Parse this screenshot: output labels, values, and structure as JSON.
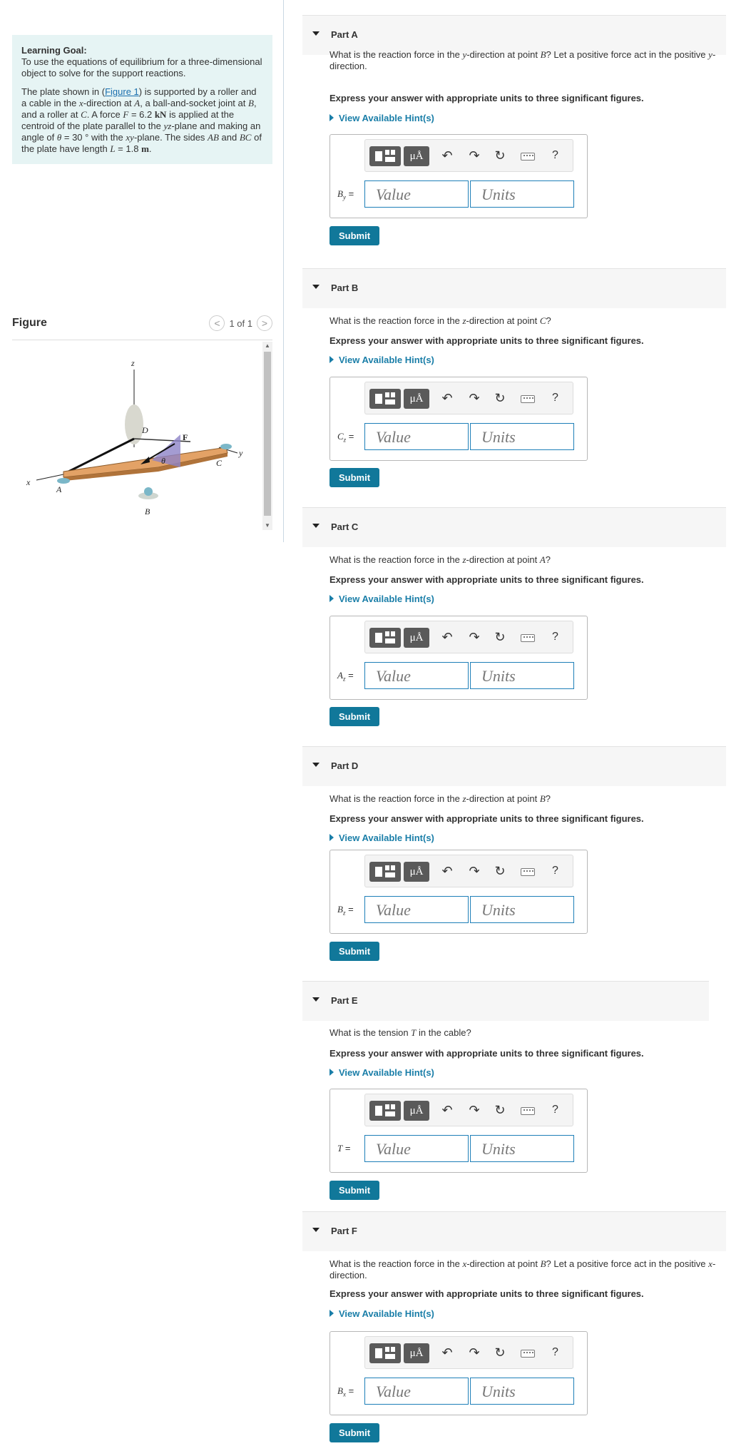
{
  "learning_goal": {
    "title": "Learning Goal:",
    "text": "To use the equations of equilibrium for a three-dimensional object to solve for the support reactions.",
    "p2_a": "The plate shown in (",
    "figure_link": "Figure 1",
    "p2_b": ") is supported by a roller and a cable in the ",
    "p2_x": "x",
    "p2_c": "-direction at ",
    "p2_A": "A",
    "p2_d": ", a ball-and-socket joint at ",
    "p2_B": "B",
    "p2_e": ", and a roller at ",
    "p2_C": "C",
    "p2_f": ". A force ",
    "p2_F": "F",
    "p2_g": " = 6.2 ",
    "p2_kN": "kN",
    "p2_h": " is applied at the centroid of the plate parallel to the ",
    "p2_yz": "yz",
    "p2_i": "-plane and making an angle of ",
    "p2_theta": "θ",
    "p2_j": " = 30 ° with the ",
    "p2_xy": "xy",
    "p2_k": "-plane. The sides ",
    "p2_AB": "AB",
    "p2_l": " and ",
    "p2_BC": "BC",
    "p2_m": " of the plate have length ",
    "p2_L": "L",
    "p2_n": " = 1.8 ",
    "p2_m_unit": "m",
    "p2_o": "."
  },
  "figure": {
    "title": "Figure",
    "pager": "1 of 1",
    "prev": "<",
    "next": ">",
    "labels": {
      "z": "z",
      "x": "x",
      "y": "y",
      "A": "A",
      "B": "B",
      "C": "C",
      "D": "D",
      "F": "F",
      "theta": "θ"
    }
  },
  "toolbar": {
    "units_label": "μÅ",
    "help": "?",
    "undo": "↶",
    "redo": "↷",
    "reset": "↻"
  },
  "common": {
    "instruct": "Express your answer with appropriate units to three significant figures.",
    "hint": "View Available Hint(s)",
    "value_placeholder": "Value",
    "units_placeholder": "Units",
    "submit": "Submit"
  },
  "parts": [
    {
      "title": "Part A",
      "q_pre": "What is the reaction force in the ",
      "q_dir": "y",
      "q_mid": "-direction at point ",
      "q_pt": "B",
      "q_post": "? Let a positive force act in the positive ",
      "q_dir2": "y",
      "q_end": "-direction.",
      "var": "B",
      "sub": "y"
    },
    {
      "title": "Part B",
      "q_pre": "What is the reaction force in the ",
      "q_dir": "z",
      "q_mid": "-direction at point ",
      "q_pt": "C",
      "q_post": "?",
      "q_dir2": "",
      "q_end": "",
      "var": "C",
      "sub": "z"
    },
    {
      "title": "Part C",
      "q_pre": "What is the reaction force in the ",
      "q_dir": "z",
      "q_mid": "-direction at point ",
      "q_pt": "A",
      "q_post": "?",
      "q_dir2": "",
      "q_end": "",
      "var": "A",
      "sub": "z"
    },
    {
      "title": "Part D",
      "q_pre": "What is the reaction force in the ",
      "q_dir": "z",
      "q_mid": "-direction at point ",
      "q_pt": "B",
      "q_post": "?",
      "q_dir2": "",
      "q_end": "",
      "var": "B",
      "sub": "z"
    },
    {
      "title": "Part E",
      "q_pre": "What is the tension ",
      "q_dir": "T",
      "q_mid": " in the cable?",
      "q_pt": "",
      "q_post": "",
      "q_dir2": "",
      "q_end": "",
      "var": "T",
      "sub": ""
    },
    {
      "title": "Part F",
      "q_pre": "What is the reaction force in the ",
      "q_dir": "x",
      "q_mid": "-direction at point ",
      "q_pt": "B",
      "q_post": "? Let a positive force act in the positive ",
      "q_dir2": "x",
      "q_end": "-direction.",
      "var": "B",
      "sub": "x"
    }
  ]
}
